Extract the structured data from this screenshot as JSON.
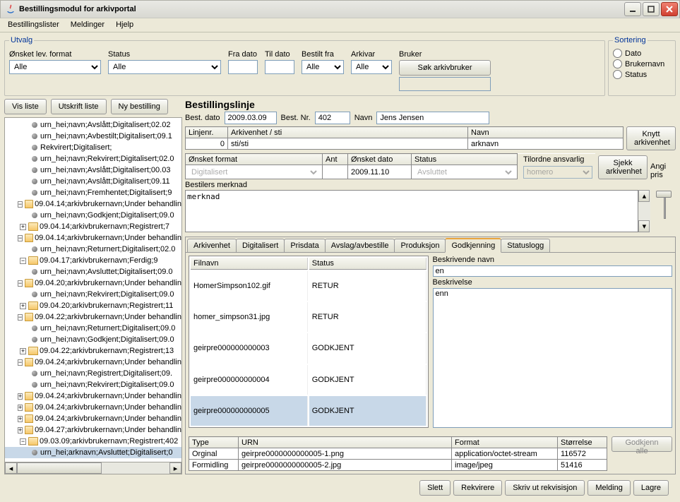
{
  "window": {
    "title": "Bestillingsmodul for arkivportal"
  },
  "menu": {
    "items": [
      "Bestillingslister",
      "Meldinger",
      "Hjelp"
    ]
  },
  "utvalg": {
    "legend": "Utvalg",
    "filters": {
      "format_label": "Ønsket lev. format",
      "format_value": "Alle",
      "status_label": "Status",
      "status_value": "Alle",
      "fra_label": "Fra dato",
      "til_label": "Til dato",
      "bestilt_label": "Bestilt fra",
      "bestilt_value": "Alle",
      "arkivar_label": "Arkivar",
      "arkivar_value": "Alle",
      "bruker_label": "Bruker",
      "sok_label": "Søk arkivbruker"
    }
  },
  "sortering": {
    "legend": "Sortering",
    "dato": "Dato",
    "brukernavn": "Brukernavn",
    "status": "Status"
  },
  "left_buttons": {
    "vis": "Vis liste",
    "utskrift": "Utskrift liste",
    "ny": "Ny bestilling"
  },
  "tree": [
    {
      "d": 2,
      "t": "leaf",
      "txt": "urn_hei;navn;Avslått;Digitalisert;02.02"
    },
    {
      "d": 2,
      "t": "leaf",
      "txt": "urn_hei;navn;Avbestilt;Digitalisert;09.1"
    },
    {
      "d": 2,
      "t": "leaf",
      "txt": "Rekvirert;Digitalisert;"
    },
    {
      "d": 2,
      "t": "leaf",
      "txt": "urn_hei;navn;Rekvirert;Digitalisert;02.0"
    },
    {
      "d": 2,
      "t": "leaf",
      "txt": "urn_hei;navn;Avslått;Digitalisert;00.03"
    },
    {
      "d": 2,
      "t": "leaf",
      "txt": "urn_hei;navn;Avslått;Digitalisert;09.11"
    },
    {
      "d": 2,
      "t": "leaf",
      "txt": "urn_hei;navn;Fremhentet;Digitalisert;9"
    },
    {
      "d": 1,
      "t": "open",
      "txt": "09.04.14;arkivbrukernavn;Under behandlin"
    },
    {
      "d": 2,
      "t": "leaf",
      "txt": "urn_hei;navn;Godkjent;Digitalisert;09.0"
    },
    {
      "d": 1,
      "t": "closed",
      "txt": "09.04.14;arkivbrukernavn;Registrert;7"
    },
    {
      "d": 1,
      "t": "open",
      "txt": "09.04.14;arkivbrukernavn;Under behandlin"
    },
    {
      "d": 2,
      "t": "leaf",
      "txt": "urn_hei;navn;Returnert;Digitalisert;02.0"
    },
    {
      "d": 1,
      "t": "open",
      "txt": "09.04.17;arkivbrukernavn;Ferdig;9"
    },
    {
      "d": 2,
      "t": "leaf",
      "txt": "urn_hei;navn;Avsluttet;Digitalisert;09.0"
    },
    {
      "d": 1,
      "t": "open",
      "txt": "09.04.20;arkivbrukernavn;Under behandlin"
    },
    {
      "d": 2,
      "t": "leaf",
      "txt": "urn_hei;navn;Rekvirert;Digitalisert;09.0"
    },
    {
      "d": 1,
      "t": "closed",
      "txt": "09.04.20;arkivbrukernavn;Registrert;11"
    },
    {
      "d": 1,
      "t": "open",
      "txt": "09.04.22;arkivbrukernavn;Under behandlin"
    },
    {
      "d": 2,
      "t": "leaf",
      "txt": "urn_hei;navn;Returnert;Digitalisert;09.0"
    },
    {
      "d": 2,
      "t": "leaf",
      "txt": "urn_hei;navn;Godkjent;Digitalisert;09.0"
    },
    {
      "d": 1,
      "t": "closed",
      "txt": "09.04.22;arkivbrukernavn;Registrert;13"
    },
    {
      "d": 1,
      "t": "open",
      "txt": "09.04.24;arkivbrukernavn;Under behandlin"
    },
    {
      "d": 2,
      "t": "leaf",
      "txt": "urn_hei;navn;Registrert;Digitalisert;09."
    },
    {
      "d": 2,
      "t": "leaf",
      "txt": "urn_hei;navn;Rekvirert;Digitalisert;09.0"
    },
    {
      "d": 1,
      "t": "closed",
      "txt": "09.04.24;arkivbrukernavn;Under behandlin"
    },
    {
      "d": 1,
      "t": "closed",
      "txt": "09.04.24;arkivbrukernavn;Under behandlin"
    },
    {
      "d": 1,
      "t": "closed",
      "txt": "09.04.24;arkivbrukernavn;Under behandlin"
    },
    {
      "d": 1,
      "t": "closed",
      "txt": "09.04.27;arkivbrukernavn;Under behandlin"
    },
    {
      "d": 1,
      "t": "open",
      "txt": "09.03.09;arkivbrukernavn;Registrert;402"
    },
    {
      "d": 2,
      "t": "leaf",
      "txt": "urn_hei;arknavn;Avsluttet;Digitalisert;0",
      "sel": true
    }
  ],
  "bl": {
    "heading": "Bestillingslinje",
    "best_dato_label": "Best. dato",
    "best_dato": "2009.03.09",
    "best_nr_label": "Best. Nr.",
    "best_nr": "402",
    "navn_label": "Navn",
    "navn": "Jens Jensen"
  },
  "linje": {
    "h_linjenr": "Linjenr.",
    "h_arkivenhet": "Arkivenhet / sti",
    "h_navn": "Navn",
    "linjenr": "0",
    "sti": "sti/sti",
    "navn": "arknavn",
    "btn_knytt": "Knytt arkivenhet",
    "btn_sjekk": "Sjekk arkivenhet"
  },
  "onsket": {
    "h_format": "Ønsket format",
    "h_ant": "Ant",
    "h_dato": "Ønsket dato",
    "h_status": "Status",
    "h_tilord": "Tilordne ansvarlig",
    "format": "Digitalisert",
    "dato": "2009.11.10",
    "status": "Avsluttet",
    "tilord": "homero",
    "angi": "Angi pris"
  },
  "merknad": {
    "label": "Bestilers merknad",
    "text": "merknad"
  },
  "tabs": [
    "Arkivenhet",
    "Digitalisert",
    "Prisdata",
    "Avslag/avbestille",
    "Produksjon",
    "Godkjenning",
    "Statuslogg"
  ],
  "active_tab": 5,
  "files": {
    "h_filnavn": "Filnavn",
    "h_status": "Status",
    "rows": [
      {
        "f": "HomerSimpson102.gif",
        "s": "RETUR"
      },
      {
        "f": "homer_simpson31.jpg",
        "s": "RETUR"
      },
      {
        "f": "geirpre000000000003",
        "s": "GODKJENT"
      },
      {
        "f": "geirpre000000000004",
        "s": "GODKJENT"
      },
      {
        "f": "geirpre000000000005",
        "s": "GODKJENT",
        "sel": true
      }
    ]
  },
  "desc": {
    "navn_label": "Beskrivende navn",
    "navn": "en",
    "beskrivelse_label": "Beskrivelse",
    "beskrivelse": "enn"
  },
  "typegrid": {
    "h_type": "Type",
    "h_urn": "URN",
    "h_format": "Format",
    "h_storrelse": "Størrelse",
    "rows": [
      {
        "t": "Orginal",
        "u": "geirpre0000000000005-1.png",
        "f": "application/octet-stream",
        "s": "116572"
      },
      {
        "t": "Formidling",
        "u": "geirpre0000000000005-2.jpg",
        "f": "image/jpeg",
        "s": "51416"
      }
    ],
    "godkjenn_alle": "Godkjenn alle"
  },
  "bottom": {
    "slett": "Slett",
    "rekvirere": "Rekvirere",
    "skriv": "Skriv ut rekvisisjon",
    "melding": "Melding",
    "lagre": "Lagre"
  }
}
